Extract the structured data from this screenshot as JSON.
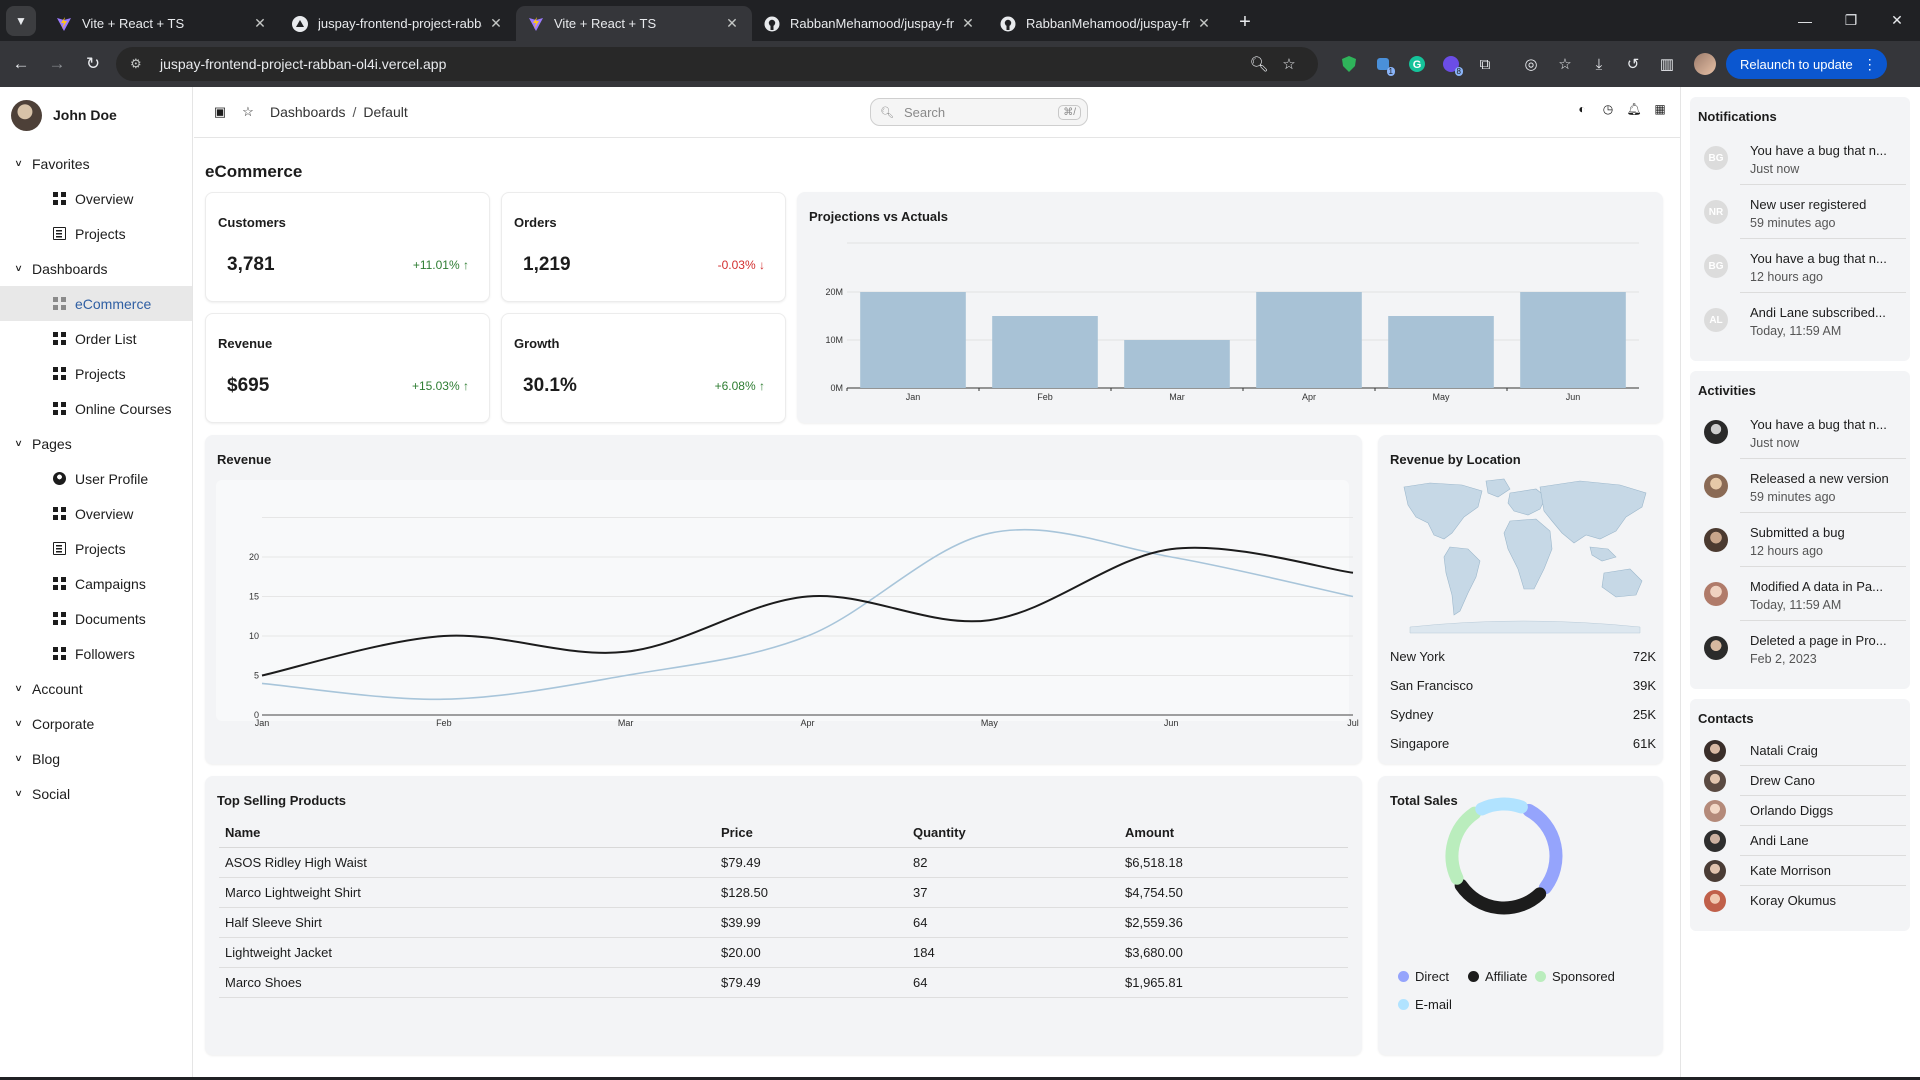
{
  "browser": {
    "tabs": [
      {
        "title": "Vite + React + TS",
        "favicon": "vite-icon",
        "active": false
      },
      {
        "title": "juspay-frontend-project-rabban",
        "favicon": "vercel-icon",
        "active": false
      },
      {
        "title": "Vite + React + TS",
        "favicon": "vite-icon",
        "active": true
      },
      {
        "title": "RabbanMehamood/juspay-fron",
        "favicon": "github-icon",
        "active": false
      },
      {
        "title": "RabbanMehamood/juspay-fron",
        "favicon": "github-icon",
        "active": false
      }
    ],
    "url": "juspay-frontend-project-rabban-ol4i.vercel.app",
    "relaunch_label": "Relaunch to update",
    "extension_badges": {
      "second": "1",
      "fourth": "8"
    }
  },
  "sidebar": {
    "user_name": "John Doe",
    "sections": {
      "favorites": "Favorites",
      "dashboards": "Dashboards",
      "pages": "Pages",
      "account": "Account",
      "corporate": "Corporate",
      "blog": "Blog",
      "social": "Social"
    },
    "favorites": [
      "Overview",
      "Projects"
    ],
    "dashboards": [
      "eCommerce",
      "Order List",
      "Projects",
      "Online Courses"
    ],
    "pages": [
      "User Profile",
      "Overview",
      "Projects",
      "Campaigns",
      "Documents",
      "Followers"
    ]
  },
  "header": {
    "breadcrumb": [
      "Dashboards",
      "Default"
    ],
    "search_placeholder": "Search",
    "search_shortcut": "⌘/"
  },
  "main": {
    "title": "eCommerce",
    "stats": [
      {
        "title": "Customers",
        "value": "3,781",
        "change": "+11.01%",
        "trend": "up"
      },
      {
        "title": "Orders",
        "value": "1,219",
        "change": "-0.03%",
        "trend": "down"
      },
      {
        "title": "Revenue",
        "value": "$695",
        "change": "+15.03%",
        "trend": "up"
      },
      {
        "title": "Growth",
        "value": "30.1%",
        "change": "+6.08%",
        "trend": "up"
      }
    ],
    "projections_title": "Projections vs Actuals",
    "revenue_title": "Revenue",
    "location_title": "Revenue by Location",
    "locations": [
      {
        "city": "New York",
        "value": "72K"
      },
      {
        "city": "San Francisco",
        "value": "39K"
      },
      {
        "city": "Sydney",
        "value": "25K"
      },
      {
        "city": "Singapore",
        "value": "61K"
      }
    ],
    "top_products": {
      "title": "Top Selling Products",
      "columns": [
        "Name",
        "Price",
        "Quantity",
        "Amount"
      ],
      "rows": [
        [
          "ASOS Ridley High Waist",
          "$79.49",
          "82",
          "$6,518.18"
        ],
        [
          "Marco Lightweight Shirt",
          "$128.50",
          "37",
          "$4,754.50"
        ],
        [
          "Half Sleeve Shirt",
          "$39.99",
          "64",
          "$2,559.36"
        ],
        [
          "Lightweight Jacket",
          "$20.00",
          "184",
          "$3,680.00"
        ],
        [
          "Marco Shoes",
          "$79.49",
          "64",
          "$1,965.81"
        ]
      ]
    },
    "total_sales": {
      "title": "Total Sales",
      "legend": [
        "Direct",
        "Affiliate",
        "Sponsored",
        "E-mail"
      ]
    }
  },
  "chart_data": [
    {
      "type": "bar",
      "title": "Projections vs Actuals",
      "categories": [
        "Jan",
        "Feb",
        "Mar",
        "Apr",
        "May",
        "Jun"
      ],
      "values": [
        20,
        15,
        10,
        20,
        15,
        20
      ],
      "y_ticks": [
        "0M",
        "10M",
        "20M"
      ],
      "ylim": [
        0,
        20
      ],
      "color": "#a8c2d6"
    },
    {
      "type": "line",
      "title": "Revenue",
      "categories": [
        "Jan",
        "Feb",
        "Mar",
        "Apr",
        "May",
        "Jun",
        "Jul"
      ],
      "y_ticks": [
        0,
        5,
        10,
        15,
        20
      ],
      "ylim": [
        0,
        25
      ],
      "series": [
        {
          "values": [
            5,
            10,
            8,
            15,
            12,
            21,
            18
          ],
          "color": "#1c1c1c"
        },
        {
          "values": [
            4,
            2,
            5,
            10,
            23,
            20,
            15
          ],
          "color": "#a8c5da"
        }
      ]
    },
    {
      "type": "pie",
      "title": "Total Sales",
      "categories": [
        "Direct",
        "Affiliate",
        "Sponsored",
        "E-mail"
      ],
      "values": [
        30,
        30,
        25,
        15
      ],
      "colors": [
        "#95a4fc",
        "#1c1c1c",
        "#baedbd",
        "#b1e3ff"
      ]
    }
  ],
  "notifications": {
    "title": "Notifications",
    "items": [
      {
        "initials": "BG",
        "text": "You have a bug that n...",
        "time": "Just now"
      },
      {
        "initials": "NR",
        "text": "New user registered",
        "time": "59 minutes ago"
      },
      {
        "initials": "BG",
        "text": "You have a bug that n...",
        "time": "12 hours ago"
      },
      {
        "initials": "AL",
        "text": "Andi Lane subscribed...",
        "time": "Today, 11:59 AM"
      }
    ]
  },
  "activities": {
    "title": "Activities",
    "items": [
      {
        "text": "You have a bug that n...",
        "time": "Just now"
      },
      {
        "text": "Released a new version",
        "time": "59 minutes ago"
      },
      {
        "text": "Submitted a bug",
        "time": "12 hours ago"
      },
      {
        "text": "Modified A data in Pa...",
        "time": "Today, 11:59 AM"
      },
      {
        "text": "Deleted a page in Pro...",
        "time": "Feb 2, 2023"
      }
    ]
  },
  "contacts": {
    "title": "Contacts",
    "items": [
      "Natali Craig",
      "Drew Cano",
      "Orlando Diggs",
      "Andi Lane",
      "Kate Morrison",
      "Koray Okumus"
    ]
  }
}
